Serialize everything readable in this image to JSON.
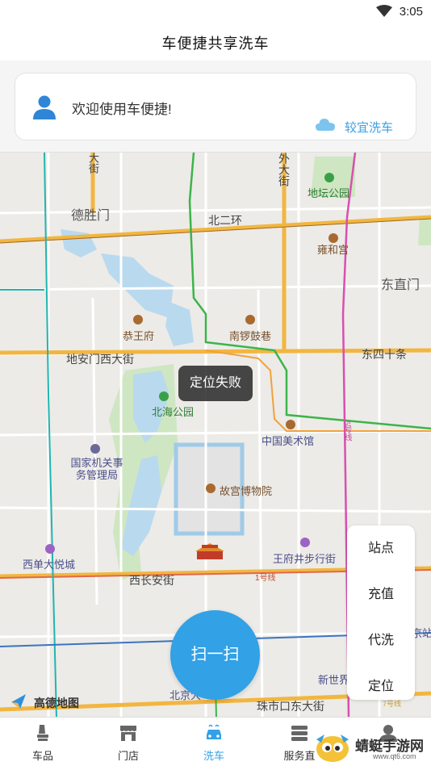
{
  "status_bar": {
    "time": "3:05",
    "wifi_icon": "wifi-icon"
  },
  "header": {
    "title": "车便捷共享洗车"
  },
  "welcome": {
    "greeting": "欢迎使用车便捷!",
    "user_icon": "user-icon",
    "weather_icon": "cloud-icon",
    "weather_text": "较宜洗车"
  },
  "map": {
    "labels": {
      "deshengmen": "德胜门",
      "beierhuan": "北二环",
      "andingmen_top": "大街",
      "outer_street": "外大街",
      "ditan": "地坛公园",
      "yonghegong": "雍和宫",
      "dongzhimen": "东直门",
      "gongwangfu": "恭王府",
      "nanluoguxiang": "南锣鼓巷",
      "dianmen": "地安门西大街",
      "dongsishitiao": "东四十条",
      "beihai": "北海公园",
      "meishuguan": "中国美术馆",
      "guoguanju": "国家机关事务管理局",
      "gugong": "故宫博物院",
      "xidan": "西单大悦城",
      "wangfujing": "王府井步行街",
      "xichanganjie": "西长安街",
      "line1": "1号线",
      "line5": "5号线",
      "xinshijie": "新世界",
      "beijing_station": "京站",
      "zhushikou": "珠市口东大街",
      "beijing_bottom": "北京大",
      "line7": "7号线"
    },
    "toast": "定位失败",
    "amap_logo": "高德地图"
  },
  "side_menu": [
    "站点",
    "充值",
    "代洗",
    "定位"
  ],
  "scan_button": "扫一扫",
  "bottom_nav": [
    {
      "label": "车品",
      "icon": "car-seat-icon",
      "active": false
    },
    {
      "label": "门店",
      "icon": "store-icon",
      "active": false
    },
    {
      "label": "洗车",
      "icon": "car-wash-icon",
      "active": true
    },
    {
      "label": "服务直",
      "icon": "service-icon",
      "active": false
    },
    {
      "label": "",
      "icon": "profile-icon",
      "active": false
    }
  ],
  "watermark": {
    "text": "蜻蜓手游网",
    "url": "www.qt6.com"
  },
  "colors": {
    "accent": "#32a1e6",
    "road_main": "#f2b640",
    "metro_green": "#3cb44a",
    "metro_pink": "#d94fb0"
  }
}
